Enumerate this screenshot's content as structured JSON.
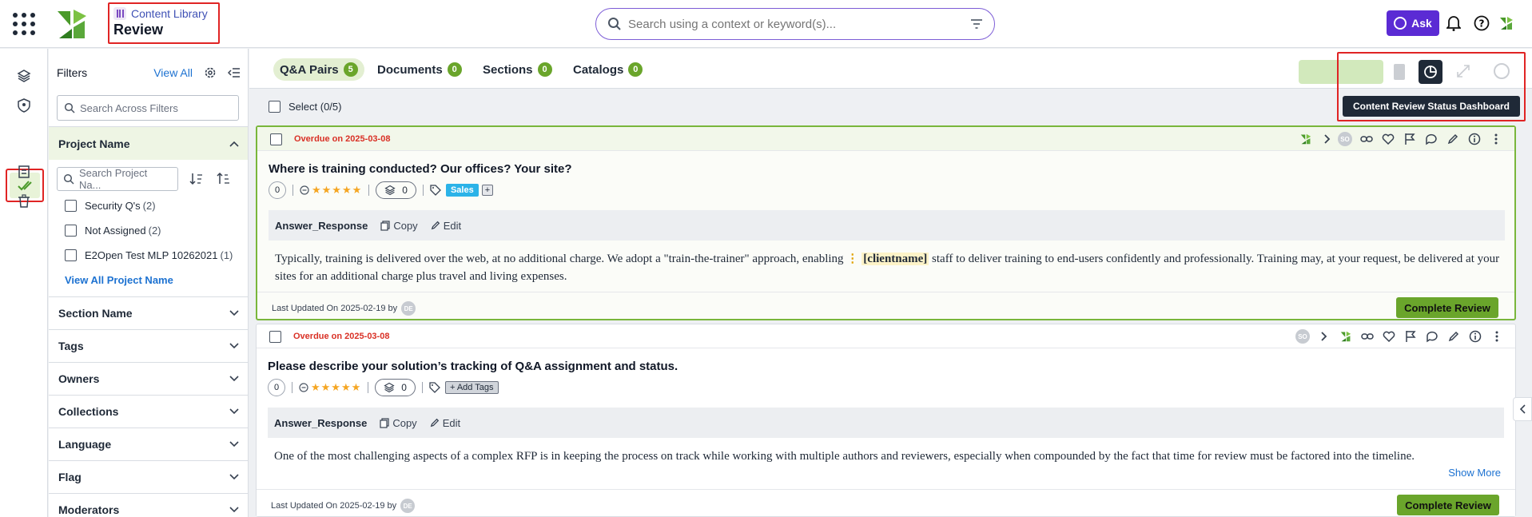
{
  "header": {
    "breadcrumb_parent": "Content Library",
    "page_title": "Review",
    "search_placeholder": "Search using a context or keyword(s)...",
    "ask_label": "Ask"
  },
  "filters": {
    "title": "Filters",
    "view_all": "View All",
    "search_placeholder": "Search Across Filters",
    "project_section": "Project Name",
    "project_search_placeholder": "Search Project Na...",
    "projects": [
      {
        "label": "Security Q's",
        "count": "(2)"
      },
      {
        "label": "Not Assigned",
        "count": "(2)"
      },
      {
        "label": "E2Open Test MLP 10262021",
        "count": "(1)"
      }
    ],
    "view_all_projects": "View All Project Name",
    "sections": [
      "Section Name",
      "Tags",
      "Owners",
      "Collections",
      "Language",
      "Flag",
      "Moderators"
    ]
  },
  "tabs": [
    {
      "label": "Q&A Pairs",
      "count": "5"
    },
    {
      "label": "Documents",
      "count": "0"
    },
    {
      "label": "Sections",
      "count": "0"
    },
    {
      "label": "Catalogs",
      "count": "0"
    }
  ],
  "toolbar": {
    "tooltip": "Content Review Status Dashboard"
  },
  "select_label": "Select (0/5)",
  "cards": [
    {
      "overdue": "Overdue on 2025-03-08",
      "question": "Where is training conducted?  Our offices?  Your site?",
      "score": "0",
      "stars": "★★★★★",
      "collections": "0",
      "tag": "Sales",
      "tag_plus": "+",
      "answer_label": "Answer_Response",
      "copy_label": "Copy",
      "edit_label": "Edit",
      "answer_pre": "Typically, training is delivered over the web, at no additional charge. We adopt a \"train-the-trainer\" approach, enabling ",
      "answer_token": "[clientname]",
      "answer_post": " staff to deliver training to end-users confidently and professionally. Training may, at your request, be delivered at your sites for an additional charge plus travel and living expenses.",
      "updated": "Last Updated On 2025-02-19 by",
      "updated_by": "DE",
      "owner_avatar": "SO",
      "complete_label": "Complete Review"
    },
    {
      "overdue": "Overdue on 2025-03-08",
      "question": "Please describe your solution’s tracking of Q&A assignment and status.",
      "score": "0",
      "stars": "★★★★★",
      "collections": "0",
      "add_tags": "+ Add Tags",
      "answer_label": "Answer_Response",
      "copy_label": "Copy",
      "edit_label": "Edit",
      "answer_text": "One of the most challenging aspects of a complex RFP is in keeping the process on track while working with multiple authors and reviewers, especially when compounded by the fact that time for review must be factored into the timeline.",
      "show_more": "Show More",
      "updated": "Last Updated On 2025-02-19 by",
      "updated_by": "DE",
      "owner_avatar": "SO",
      "complete_label": "Complete Review"
    }
  ],
  "colors": {
    "accent_green": "#6aa52b",
    "ask_purple": "#5b2bd4",
    "overdue_red": "#d93025",
    "link_blue": "#1d72d1",
    "highlight_red": "#e02424"
  }
}
